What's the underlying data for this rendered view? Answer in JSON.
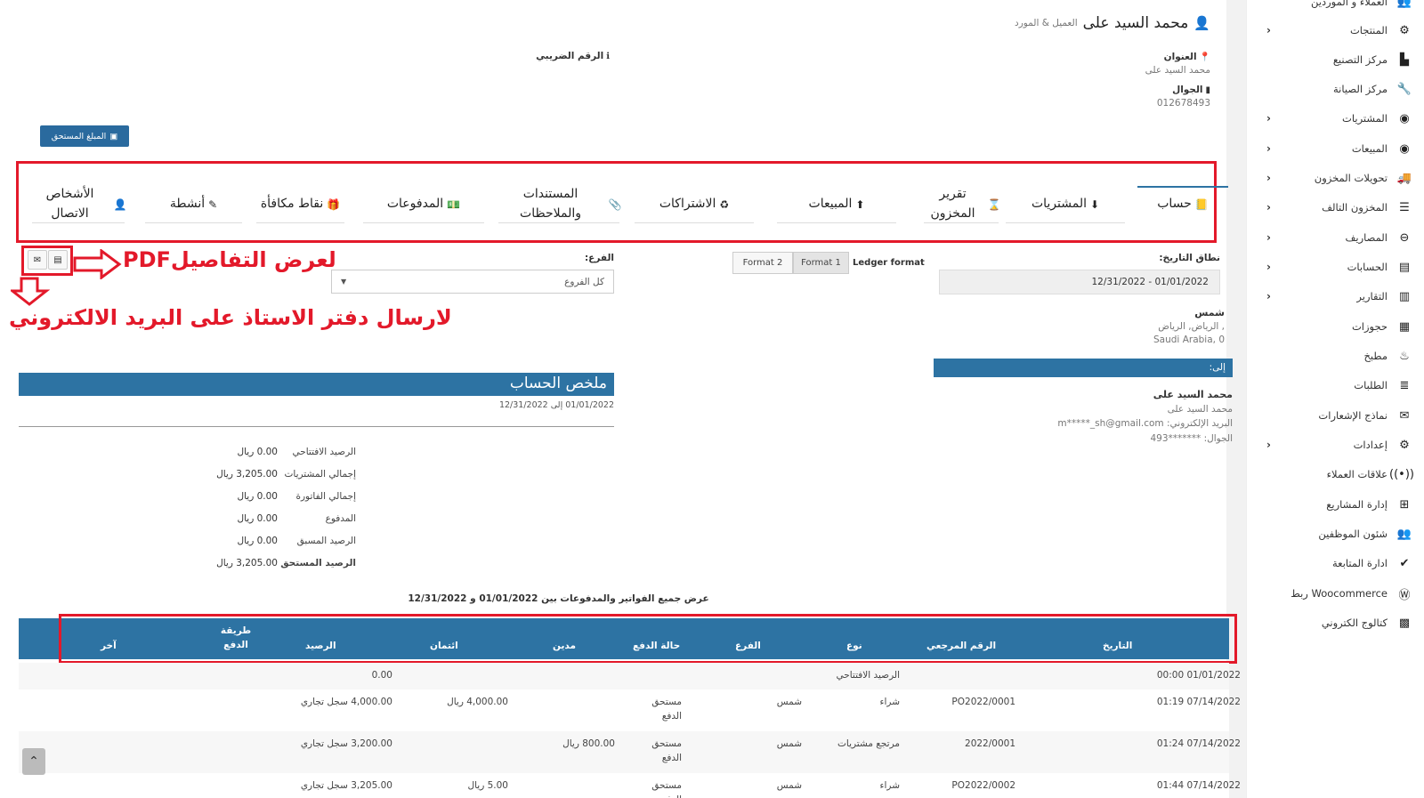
{
  "sidebar": {
    "items": [
      {
        "label": "العملاء و الموردين",
        "icon": "users-icon",
        "glyph": "👥",
        "chevron": false
      },
      {
        "label": "المنتجات",
        "icon": "cubes-icon",
        "glyph": "⚙",
        "chevron": true
      },
      {
        "label": "مركز التصنيع",
        "icon": "factory-icon",
        "glyph": "▙",
        "chevron": false
      },
      {
        "label": "مركز الصيانة",
        "icon": "wrench-icon",
        "glyph": "🔧",
        "chevron": false
      },
      {
        "label": "المشتريات",
        "icon": "arrow-down-circle-icon",
        "glyph": "◉",
        "chevron": true
      },
      {
        "label": "المبيعات",
        "icon": "arrow-up-circle-icon",
        "glyph": "◉",
        "chevron": true
      },
      {
        "label": "تحويلات المخزون",
        "icon": "truck-icon",
        "glyph": "🚚",
        "chevron": true
      },
      {
        "label": "المخزون التالف",
        "icon": "database-icon",
        "glyph": "☰",
        "chevron": true
      },
      {
        "label": "المصاريف",
        "icon": "minus-circle-icon",
        "glyph": "⊖",
        "chevron": true
      },
      {
        "label": "الحسابات",
        "icon": "credit-card-icon",
        "glyph": "▤",
        "chevron": true
      },
      {
        "label": "التقارير",
        "icon": "chart-icon",
        "glyph": "▥",
        "chevron": true
      },
      {
        "label": "حجوزات",
        "icon": "calendar-icon",
        "glyph": "▦",
        "chevron": false
      },
      {
        "label": "مطبخ",
        "icon": "fire-icon",
        "glyph": "♨",
        "chevron": false
      },
      {
        "label": "الطلبات",
        "icon": "list-icon",
        "glyph": "≣",
        "chevron": false
      },
      {
        "label": "نماذج الإشعارات",
        "icon": "envelope-icon",
        "glyph": "✉",
        "chevron": false
      },
      {
        "label": "إعدادات",
        "icon": "gear-icon",
        "glyph": "⚙",
        "chevron": true
      },
      {
        "label": "علاقات العملاء",
        "icon": "broadcast-icon",
        "glyph": "((•))",
        "chevron": false
      },
      {
        "label": "إدارة المشاريع",
        "icon": "project-icon",
        "glyph": "⊞",
        "chevron": false
      },
      {
        "label": "شئون الموظفين",
        "icon": "employees-icon",
        "glyph": "👥",
        "chevron": false
      },
      {
        "label": "ادارة المتابعة",
        "icon": "check-circle-icon",
        "glyph": "✔",
        "chevron": false
      },
      {
        "label": "Woocommerce ربط",
        "icon": "wordpress-icon",
        "glyph": "Ⓦ",
        "chevron": false
      },
      {
        "label": "كتالوج الكتروني",
        "icon": "qrcode-icon",
        "glyph": "▩",
        "chevron": false
      }
    ]
  },
  "contact": {
    "name": "محمد السيد على",
    "type": "العميل & المورد",
    "address_label": "العنوان",
    "address_value": "محمد السيد على",
    "mobile_label": "الجوال",
    "mobile_value": "012678493",
    "tax_label": "الرقم الضريبي",
    "due_button": "المبلغ المستحق"
  },
  "tabs": [
    {
      "label": "حساب",
      "icon": "book-icon",
      "glyph": "📒",
      "active": true
    },
    {
      "label": "المشتريات",
      "icon": "arrow-down-circle-icon",
      "glyph": "⬇",
      "active": false
    },
    {
      "label": "تقرير المخزون",
      "icon": "hourglass-icon",
      "glyph": "⌛",
      "active": false
    },
    {
      "label": "المبيعات",
      "icon": "arrow-up-circle-icon",
      "glyph": "⬆",
      "active": false
    },
    {
      "label": "الاشتراكات",
      "icon": "recycle-icon",
      "glyph": "♻",
      "active": false
    },
    {
      "label": "المستندات والملاحظات",
      "icon": "paperclip-icon",
      "glyph": "📎",
      "active": false
    },
    {
      "label": "المدفوعات",
      "icon": "money-icon",
      "glyph": "💵",
      "active": false
    },
    {
      "label": "نقاط مكافأة",
      "icon": "gift-icon",
      "glyph": "🎁",
      "active": false
    },
    {
      "label": "أنشطة",
      "icon": "edit-icon",
      "glyph": "✎",
      "active": false
    },
    {
      "label": "الأشخاص الاتصال",
      "icon": "user-plus-icon",
      "glyph": "👤",
      "active": false
    }
  ],
  "filters": {
    "date_range_label": "نطاق التاريخ:",
    "date_range_value": "12/31/2022 - 01/01/2022",
    "ledger_format_label": "Ledger format",
    "format1": "Format 1",
    "format2": "Format 2",
    "branch_label": "الفرع:",
    "branch_value": "كل الفروع"
  },
  "annotations": {
    "pdf_note": "لعرض التفاصيلPDF",
    "email_note": "لارسال دفتر الاستاذ على البريد الالكتروني"
  },
  "business": {
    "name": "شمس",
    "city": ", الرياض, الرياض",
    "country": "Saudi Arabia, 0"
  },
  "recipient": {
    "to_label": "إلى:",
    "name": "محمد السيد على",
    "subname": "محمد السيد على",
    "email_label": "البريد الإلكتروني:",
    "email_value": "m*****_sh@gmail.com",
    "mobile_label": "الجوال:",
    "mobile_value": "*******493"
  },
  "summary": {
    "title": "ملخص الحساب",
    "period": "01/01/2022 إلى 12/31/2022",
    "rows": [
      {
        "label": "الرصيد الافتتاحي",
        "value": "0.00 ريال",
        "bold": false
      },
      {
        "label": "إجمالي المشتريات",
        "value": "3,205.00 ريال",
        "bold": false
      },
      {
        "label": "إجمالي الفاتورة",
        "value": "0.00 ريال",
        "bold": false
      },
      {
        "label": "المدفوع",
        "value": "0.00 ريال",
        "bold": false
      },
      {
        "label": "الرصيد المسبق",
        "value": "0.00 ريال",
        "bold": false
      },
      {
        "label": "الرصيد المستحق",
        "value": "3,205.00 ريال",
        "bold": true
      }
    ]
  },
  "ledger": {
    "caption": "عرض جميع الفواتير والمدفوعات بين 01/01/2022 و 12/31/2022",
    "headers": {
      "date": "التاريخ",
      "ref": "الرقم المرجعي",
      "type": "نوع",
      "branch": "الفرع",
      "payment_status": "حالة الدفع",
      "debit": "مدين",
      "credit": "ائتمان",
      "balance": "الرصيد",
      "method": "طريقة الدفع",
      "other": "آخر"
    },
    "rows": [
      {
        "date": "01/01/2022 00:00",
        "ref": "",
        "type": "الرصيد الافتتاحي",
        "branch": "",
        "status": "",
        "debit": "",
        "credit": "",
        "balance": "0.00",
        "method": ""
      },
      {
        "date": "07/14/2022 01:19",
        "ref": "PO2022/0001",
        "type": "شراء",
        "branch": "شمس",
        "status": "مستحق الدفع",
        "debit": "",
        "credit": "4,000.00 ريال",
        "balance": "4,000.00 سجل تجاري",
        "method": ""
      },
      {
        "date": "07/14/2022 01:24",
        "ref": "2022/0001",
        "type": "مرتجع مشتريات",
        "branch": "شمس",
        "status": "مستحق الدفع",
        "debit": "800.00 ريال",
        "credit": "",
        "balance": "3,200.00 سجل تجاري",
        "method": ""
      },
      {
        "date": "07/14/2022 01:44",
        "ref": "PO2022/0002",
        "type": "شراء",
        "branch": "شمس",
        "status": "مستحق الدفع",
        "debit": "",
        "credit": "5.00 ريال",
        "balance": "3,205.00 سجل تجاري",
        "method": ""
      }
    ]
  }
}
